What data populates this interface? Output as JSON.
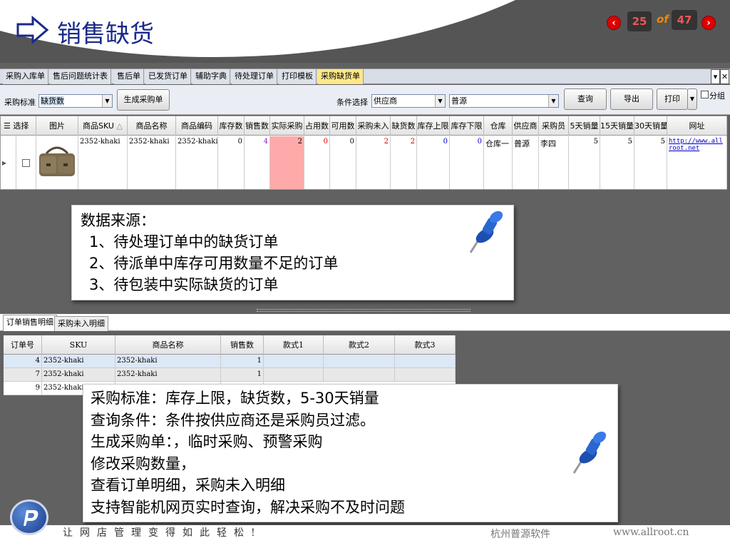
{
  "slide": {
    "title": "销售缺货",
    "current_page": "25",
    "of_label": "of",
    "total_pages": "47",
    "prev_glyph": "‹",
    "next_glyph": "›"
  },
  "tabs": [
    "采购入库单",
    "售后问题统计表",
    "售后单",
    "已发货订单",
    "辅助字典",
    "待处理订单",
    "打印模板",
    "采购缺货单"
  ],
  "window_controls": {
    "dropdown": "▾",
    "close": "✕"
  },
  "toolbar": {
    "purchase_standard_label": "采购标准",
    "purchase_standard_value": "缺货数",
    "create_po_button": "生成采购单",
    "condition_label": "条件选择",
    "condition_field": "供应商",
    "condition_value": "普源",
    "query_button": "查询",
    "export_button": "导出",
    "print_button": "打印",
    "group_checkbox": "分组"
  },
  "main_grid": {
    "columns": [
      "选择",
      "图片",
      "商品SKU",
      "商品名称",
      "商品编码",
      "库存数",
      "销售数",
      "实际采购",
      "占用数",
      "可用数",
      "采购未入",
      "缺货数",
      "库存上限",
      "库存下限",
      "仓库",
      "供应商",
      "采购员",
      "5天销量",
      "15天销量",
      "30天销量",
      "网址"
    ],
    "sort_glyph": "△",
    "row": {
      "sku": "2352-khaki",
      "name": "2352-khaki",
      "code": "2352-khaki",
      "stock": "0",
      "sales": "4",
      "actual_purchase": "2",
      "occupied": "0",
      "available": "0",
      "purchase_pending": "2",
      "shortage": "2",
      "stock_upper": "0",
      "stock_lower": "0",
      "warehouse": "仓库一",
      "supplier": "普源",
      "buyer": "李四",
      "sales_5d": "5",
      "sales_15d": "5",
      "sales_30d": "5",
      "url": "http://www.allroot.net"
    }
  },
  "note1": {
    "lines": [
      "数据来源：",
      "1、待处理订单中的缺货订单",
      "2、待派单中库存可用数量不足的订单",
      "3、待包装中实际缺货的订单"
    ]
  },
  "sub_tabs": [
    "订单销售明细",
    "采购未入明细"
  ],
  "detail_grid": {
    "columns": [
      "订单号",
      "SKU",
      "商品名称",
      "销售数",
      "款式1",
      "款式2",
      "款式3"
    ],
    "rows": [
      {
        "order": "4",
        "sku": "2352-khaki",
        "name": "2352-khaki",
        "qty": "1"
      },
      {
        "order": "7",
        "sku": "2352-khaki",
        "name": "2352-khaki",
        "qty": "1"
      },
      {
        "order": "9",
        "sku": "2352-khaki",
        "name": "",
        "qty": ""
      }
    ]
  },
  "note2": {
    "lines": [
      "采购标准：库存上限，缺货数，5-30天销量",
      "查询条件：条件按供应商还是采购员过滤。",
      "生成采购单：，临时采购、预警采购",
      "修改采购数量，",
      "查看订单明细，采购未入明细",
      "支持智能机网页实时查询，解决采购不及时问题"
    ]
  },
  "footer": {
    "slogan": "让网店管理变得如此轻松!",
    "company": "杭州普源软件",
    "website": "www.allroot.cn"
  },
  "colors": {
    "accent": "#1a2a8a",
    "active_tab": "#ffe88a",
    "highlight_cell": "#ffaaaa",
    "nav_red": "#dd0000"
  }
}
